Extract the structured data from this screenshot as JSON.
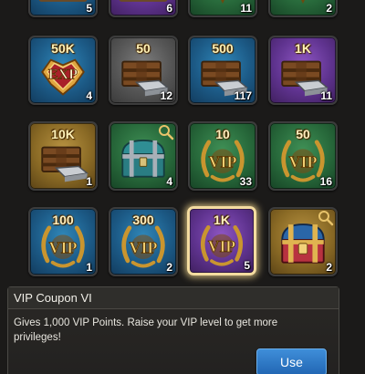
{
  "top_row": [
    {
      "rarity": "blue",
      "icon": "scroll-icon",
      "count": "5"
    },
    {
      "rarity": "purple",
      "icon": "scroll-icon",
      "count": "6"
    },
    {
      "rarity": "green",
      "icon": "medal-icon",
      "count": "11"
    },
    {
      "rarity": "green",
      "icon": "medal-icon",
      "count": "2"
    }
  ],
  "row1": [
    {
      "rarity": "blue",
      "icon": "exp-badge-icon",
      "amount": "50K",
      "badge_text": "EXP",
      "count": "4"
    },
    {
      "rarity": "grey",
      "icon": "resource-crate-icon",
      "amount": "50",
      "count": "12"
    },
    {
      "rarity": "blue",
      "icon": "resource-crate-icon",
      "amount": "500",
      "count": "117"
    },
    {
      "rarity": "purple",
      "icon": "resource-crate-icon",
      "amount": "1K",
      "count": "11"
    }
  ],
  "row2": [
    {
      "rarity": "gold",
      "icon": "resource-crate-icon",
      "amount": "10K",
      "count": "1"
    },
    {
      "rarity": "green",
      "icon": "teal-chest-icon",
      "count": "4",
      "magnifier": true
    },
    {
      "rarity": "green",
      "icon": "vip-coupon-icon",
      "amount": "10",
      "badge_text": "VIP",
      "count": "33"
    },
    {
      "rarity": "green",
      "icon": "vip-coupon-icon",
      "amount": "50",
      "badge_text": "VIP",
      "count": "16"
    }
  ],
  "row3": [
    {
      "rarity": "blue",
      "icon": "vip-coupon-icon",
      "amount": "100",
      "badge_text": "VIP",
      "count": "1"
    },
    {
      "rarity": "blue",
      "icon": "vip-coupon-icon",
      "amount": "300",
      "badge_text": "VIP",
      "count": "2"
    },
    {
      "rarity": "purple",
      "icon": "vip-coupon-icon",
      "amount": "1K",
      "badge_text": "VIP",
      "count": "5",
      "selected": true
    },
    {
      "rarity": "gold",
      "icon": "treasure-chest-icon",
      "count": "2",
      "magnifier": true
    }
  ],
  "details": {
    "title": "VIP Coupon VI",
    "description": "Gives 1,000 VIP Points. Raise your VIP level to get more privileges!",
    "use_label": "Use"
  },
  "colors": {
    "gold_text": "#fff2b8",
    "use_button": "#2f7ac8",
    "selected_border": "#f4dca0"
  }
}
